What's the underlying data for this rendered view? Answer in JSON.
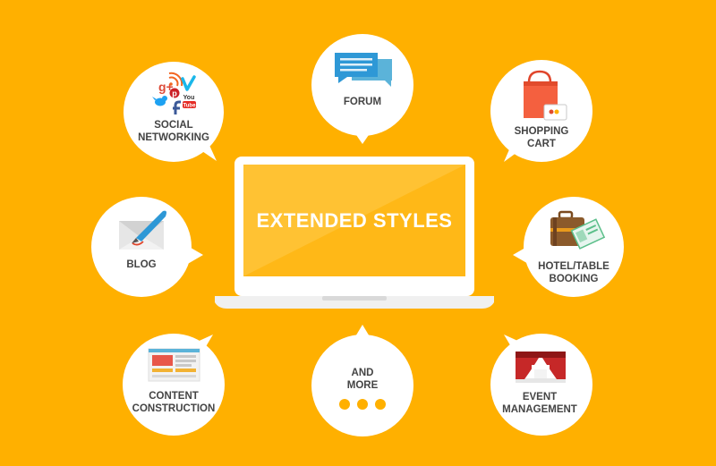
{
  "center": {
    "title": "EXTENDED STYLES"
  },
  "nodes": {
    "social": {
      "line1": "SOCIAL",
      "line2": "NETWORKING",
      "icon_text": {
        "gplus": "g+",
        "youtube_top": "You",
        "youtube_bottom": "Tube"
      }
    },
    "forum": {
      "line1": "FORUM"
    },
    "shopping": {
      "line1": "SHOPPING",
      "line2": "CART"
    },
    "blog": {
      "line1": "BLOG"
    },
    "hotel": {
      "line1": "HOTEL/TABLE",
      "line2": "BOOKING"
    },
    "content": {
      "line1": "CONTENT",
      "line2": "CONSTRUCTION"
    },
    "more": {
      "line1": "AND",
      "line2": "MORE"
    },
    "event": {
      "line1": "EVENT",
      "line2": "MANAGEMENT"
    }
  },
  "colors": {
    "background": "#FFB000",
    "bubble": "#FFFFFF",
    "label": "#444444",
    "screen": "#FFC233",
    "dots": "#FFB000"
  },
  "icons": {
    "social": "social-media-cluster-icon",
    "forum": "chat-bubbles-icon",
    "shopping": "shopping-bag-icon",
    "blog": "quill-pen-icon",
    "hotel": "suitcase-ticket-icon",
    "content": "webpage-layout-icon",
    "more": "ellipsis-dots-icon",
    "event": "theater-curtain-icon"
  }
}
